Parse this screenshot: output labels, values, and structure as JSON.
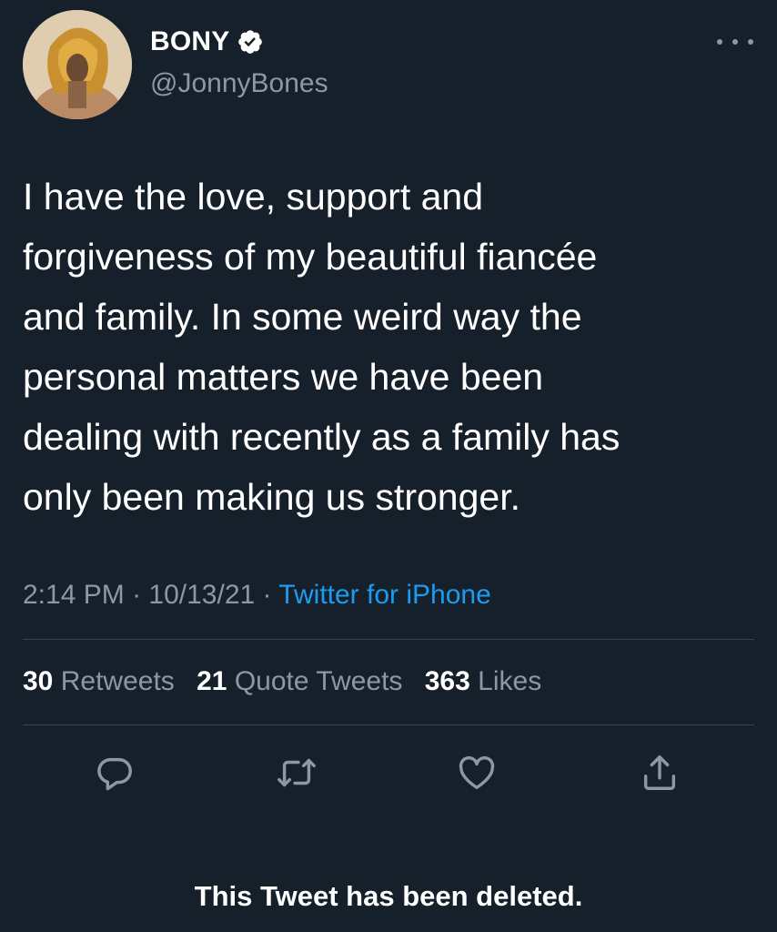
{
  "author": {
    "display_name": "BONY",
    "handle": "@JonnyBones",
    "verified": true,
    "avatar_icon": "lion-headdress-avatar"
  },
  "header": {
    "more_icon": "more-horizontal-icon"
  },
  "tweet": {
    "text": "I have the love, support and\nforgiveness of my beautiful fiancée\nand family. In some weird way the\npersonal matters we have been\ndealing with recently as a family has\nonly been making us stronger.",
    "time": "2:14 PM",
    "separator": " · ",
    "date": "10/13/21",
    "source": "Twitter for iPhone"
  },
  "stats": {
    "retweets_count": "30",
    "retweets_label": "Retweets",
    "quotes_count": "21",
    "quotes_label": "Quote Tweets",
    "likes_count": "363",
    "likes_label": "Likes"
  },
  "actions": [
    {
      "name": "reply",
      "icon": "reply-icon"
    },
    {
      "name": "retweet",
      "icon": "retweet-icon"
    },
    {
      "name": "like",
      "icon": "heart-icon"
    },
    {
      "name": "share",
      "icon": "share-icon"
    }
  ],
  "notice": {
    "text": "This Tweet has been deleted."
  },
  "colors": {
    "background": "#15202b",
    "text": "#ffffff",
    "secondary": "#8b98a5",
    "link": "#1d9bf0",
    "divider": "#38444d"
  }
}
